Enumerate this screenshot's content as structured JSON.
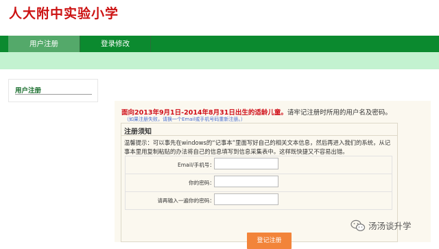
{
  "header": {
    "title": "人大附中实验小学"
  },
  "nav": {
    "items": [
      {
        "label": "用户注册",
        "active": true
      },
      {
        "label": "登录修改",
        "active": false
      }
    ]
  },
  "sidebar": {
    "title": "用户注册"
  },
  "main": {
    "notice_highlight": "面向2013年9月1日-2014年8月31日出生的适龄儿童。",
    "notice_rest": "请牢记注册时所用的用户名及密码。",
    "notice_link": "（如果注册失败，请换一个Email或手机号码重新注册。）",
    "form": {
      "heading": "注册须知",
      "tip": "温馨提示：可以事先在windows的“记事本”里面写好自己的相关文本信息，然后再进入我们的系统，从记事本里用复制粘贴的办法将自己的信息填写到信息采集表中。这样既快捷又不容易出错。",
      "fields": [
        {
          "label": "Email/手机号：",
          "value": ""
        },
        {
          "label": "你的密码：",
          "value": ""
        },
        {
          "label": "请再输入一遍你的密码：",
          "value": ""
        }
      ],
      "submit_label": "登记注册"
    }
  },
  "watermark": {
    "text": "汤汤谈升学",
    "icon": "wechat-icon"
  },
  "colors": {
    "title_red": "#cc1111",
    "nav_green": "#0b8a2f",
    "nav_active": "#54a96a",
    "subbar": "#c3f2d0",
    "button_orange": "#f2843a",
    "notice_red": "#d0101a"
  }
}
